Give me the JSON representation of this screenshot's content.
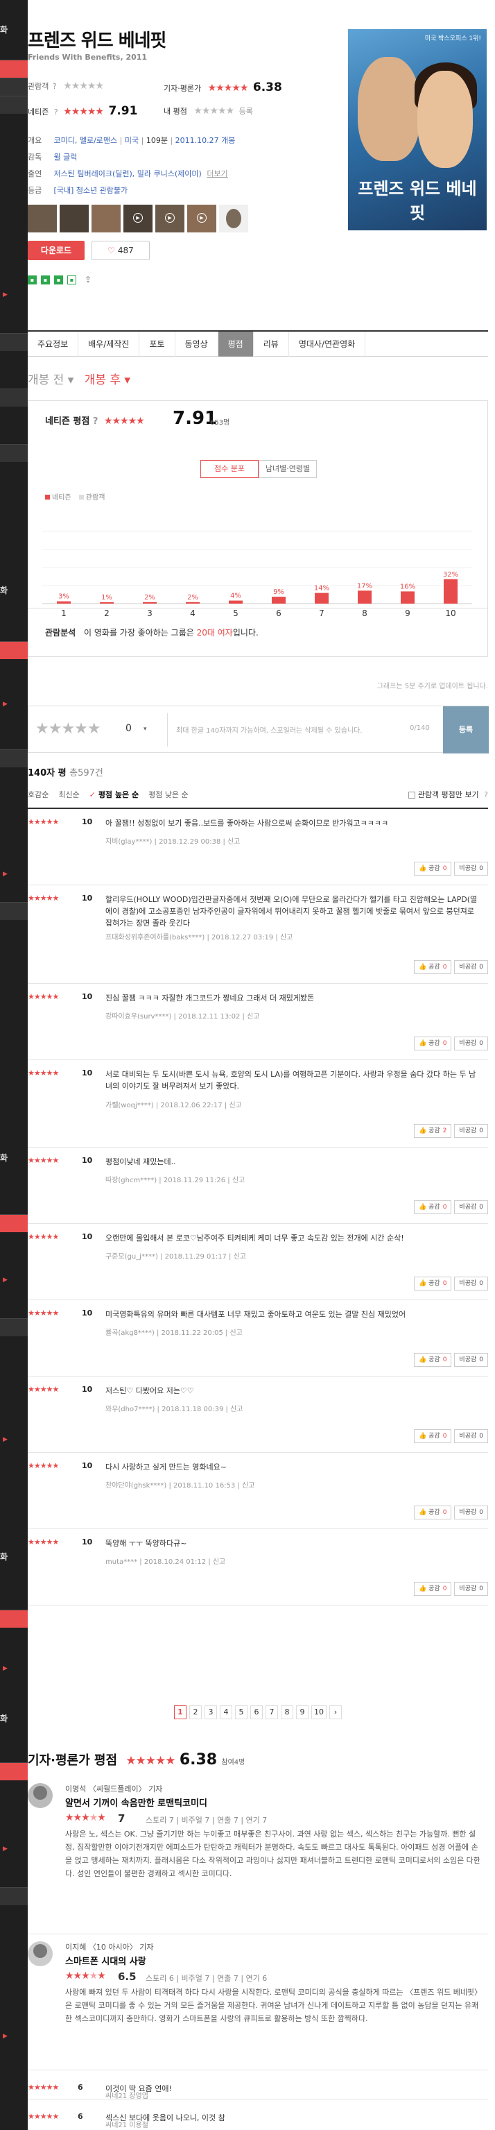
{
  "left_bar": {
    "labels": [
      "화",
      "화",
      "화",
      "화",
      "화"
    ],
    "subs": [
      "기",
      "기",
      "기",
      "기",
      "기",
      "기"
    ]
  },
  "movie": {
    "title": "프렌즈 위드 베네핏",
    "subtitle": "Friends With Benefits, 2011",
    "audience_label": "관람객",
    "critic_label": "기자·평론가",
    "critic_score": "6.38",
    "netizen_label": "네티즌",
    "netizen_score": "7.91",
    "my_label": "내 평점",
    "register": "등록",
    "overview_label": "개요",
    "genre": "코미디, 멜로/로맨스",
    "country": "미국",
    "runtime": "109분",
    "release": "2011.10.27 개봉",
    "director_label": "감독",
    "director": "윌 글럭",
    "cast_label": "출연",
    "cast": "저스틴 팀버레이크(딜런), 밀라 쿠니스(제이미)",
    "cast_more": "더보기",
    "rating_label": "등급",
    "rating": "[국내] 청소년 관람불가",
    "download": "다운로드",
    "likes": "487",
    "poster_top": "미국 박스오피스 1위!",
    "poster_title": "프렌즈 위드 베네핏"
  },
  "tabs": [
    "주요정보",
    "배우/제작진",
    "포토",
    "동영상",
    "평점",
    "리뷰",
    "명대사/연관영화"
  ],
  "release_toggle": {
    "before": "개봉 전",
    "after": "개봉 후"
  },
  "netizen_box": {
    "label": "네티즌 평점",
    "score": "7.91",
    "count": "653명",
    "tab_dist": "점수 분포",
    "tab_age": "남녀별·연령별",
    "legend_a": "네티즌",
    "legend_b": "관람객",
    "analysis_label": "관람분석",
    "analysis_text_1": "이 영화를 가장 좋아하는 그룹은",
    "analysis_highlight": "20대 여자",
    "analysis_text_2": "입니다.",
    "note": "그래프는 5분 주기로 업데이트 됩니다."
  },
  "chart_data": {
    "type": "bar",
    "categories": [
      "1",
      "2",
      "3",
      "4",
      "5",
      "6",
      "7",
      "8",
      "9",
      "10"
    ],
    "series": [
      {
        "name": "네티즌",
        "values": [
          3,
          1,
          2,
          2,
          4,
          9,
          14,
          17,
          16,
          32
        ]
      }
    ],
    "value_labels": [
      "3%",
      "1%",
      "2%",
      "2%",
      "4%",
      "9%",
      "14%",
      "17%",
      "16%",
      "32%"
    ],
    "ylim": [
      0,
      100
    ],
    "colors": {
      "bar": "#e84b4b"
    }
  },
  "write": {
    "zero": "0",
    "placeholder": "최대 한글 140자까지 가능하며, 스포일러는 삭제될 수 있습니다.",
    "counter": "0/140",
    "submit": "등록"
  },
  "reviews_header": {
    "title": "140자 평",
    "count": "총597건"
  },
  "sort": [
    "호감순",
    "최신순",
    "평점 높은 순",
    "평점 낮은 순"
  ],
  "filter_label": "관람객 평점만 보기",
  "vote": {
    "up": "공감",
    "down": "비공감"
  },
  "reviews": [
    {
      "score": "10",
      "text": "아 꿀잼!! 성정없이 보기 좋음..보드를 좋아하는 사람으로써 순화이므로 반가워고ㅋㅋㅋㅋ",
      "meta": "지비(glay****) | 2018.12.29 00:38 | 신고",
      "up": "0",
      "down": "0"
    },
    {
      "score": "10",
      "text": "할리우드(HOLLY WOOD)입간판글자중에서 첫번째 오(O)에 무단으로 올라간다가 헬기를 타고 진압해오는 LAPD(열에이 경찰)에 고소공포증인 남자주인공이 글자위에서 뛰어내리지 못하고 꿀잼 헬기에 밧줄로 묶여서 앞으로 붕던져로 잡혀가는 장면 졸라 웃긴다",
      "meta": "프대화성위후존여하를(baks****) | 2018.12.27 03:19 | 신고",
      "up": "0",
      "down": "0"
    },
    {
      "score": "10",
      "text": "진심 꿀잼 ㅋㅋㅋ 자잘한 개그코드가 짱네요 그래서 더 재밌게봤돈",
      "meta": "강따이효우(surv****) | 2018.12.11 13:02 | 신고",
      "up": "0",
      "down": "0"
    },
    {
      "score": "10",
      "text": "서로 대비되는 두 도시(바쁜 도시 뉴욕, 호양의 도시 LA)를 여행하고픈 기분이다. 사랑과 우정을 숨다 갔다 하는 두 남녀의 이야기도 잘 버무려져서 보기 좋았다.",
      "meta": "가쩰(woqj****) | 2018.12.06 22:17 | 신고",
      "up": "2",
      "down": "0"
    },
    {
      "score": "10",
      "text": "평점이낮네 재밌는데..",
      "meta": "따장(ghcm****) | 2018.11.29 11:26 | 신고",
      "up": "0",
      "down": "0"
    },
    {
      "score": "10",
      "text": "오랜만에 몰입해서 본 로코♡남주여주 티켜테케 케미 너무 좋고 속도감 있는 전개에 시간 순삭!",
      "meta": "구준모(gu_j****) | 2018.11.29 01:17 | 신고",
      "up": "0",
      "down": "0"
    },
    {
      "score": "10",
      "text": "미국영화특유의 유머와 빠른 대사템포 너무 재밌고 좋아토하고 여운도 있는 결말 진심 재밌었어",
      "meta": "률곡(akg8****) | 2018.11.22 20:05 | 신고",
      "up": "0",
      "down": "0"
    },
    {
      "score": "10",
      "text": "저스틴♡ 다봤어요 저는♡♡",
      "meta": "와우(dho7****) | 2018.11.18 00:39 | 신고",
      "up": "0",
      "down": "0"
    },
    {
      "score": "10",
      "text": "다시 사랑하고 싶게 만드는 영화네요~",
      "meta": "찬야단야(ghsk****) | 2018.11.10 16:53 | 신고",
      "up": "0",
      "down": "0"
    },
    {
      "score": "10",
      "text": "뚝양해 ㅜㅜ 뚝양하다규~",
      "meta": "muta**** | 2018.10.24 01:12 | 신고",
      "up": "0",
      "down": "0"
    }
  ],
  "pager": [
    "1",
    "2",
    "3",
    "4",
    "5",
    "6",
    "7",
    "8",
    "9",
    "10",
    "›"
  ],
  "critics_header": {
    "title": "기자·평론가 평점",
    "score": "6.38",
    "count": "참여4명"
  },
  "critics": [
    {
      "name": "이명석 〈씨월드플레이〉 기자",
      "headline": "얄면서 기꺼이 속음만한 로맨틱코미디",
      "score": "7",
      "sub": "스토리 7 | 비주얼 7 | 연출 7 | 연기 7",
      "body": "사랑은 노, 섹스는 OK. 그냥 즐기기만 하는 누이좋고 매부좋은 친구사이. 과연 사랑 없는 섹스, 섹스하는 친구는 가능할까. 뻔한 설정, 짐작할만한 이야기전개지만 에피소드가 탄탄하고 캐릭터가 분명하다. 속도도 빠르고 대사도 톡톡튄다. 아이패드 성경 어플에 손을 얹고 맹세하는 재치까지. 플래시몹은 다소 작위적이고 과잉이나 싫지만 패셔너블하고 트렌디한 로맨틱 코미디로서의 소임은 다한다. 성인 연인들이 불편한 경쾌하고 섹시한 코미디다."
    },
    {
      "name": "이지혜 〈10 아시아〉 기자",
      "headline": "스마트폰 시대의 사랑",
      "score": "6.5",
      "sub": "스토리 6 | 비주얼 7 | 연출 7 | 연기 6",
      "body": "사랑에 빠져 있던 두 사람이 티격태격 하다 다시 사랑을 시작한다. 로맨틱 코미디의 공식을 충실하게 따르는 〈프렌즈 위드 베네핏〉은 로맨틱 코미디를 좋 수 있는 거의 모든 즐거움을 제공한다. 귀여운 남녀가 신나게 데이트하고 지루할 틈 없이 농담을 던지는 유쾌한 섹스코미디까지 충만하다. 영화가 스마트폰을 사랑의 큐피트로 활용하는 방식 또한 깜찍하다."
    }
  ],
  "critic_minis": [
    {
      "score": "6",
      "title": "이것이 딱 요즘 연애!",
      "author": "씨네21 장영엽"
    },
    {
      "score": "6",
      "title": "섹스신 보다에 웃음이 나오니, 이것 참",
      "author": "씨네21 이용철"
    }
  ]
}
